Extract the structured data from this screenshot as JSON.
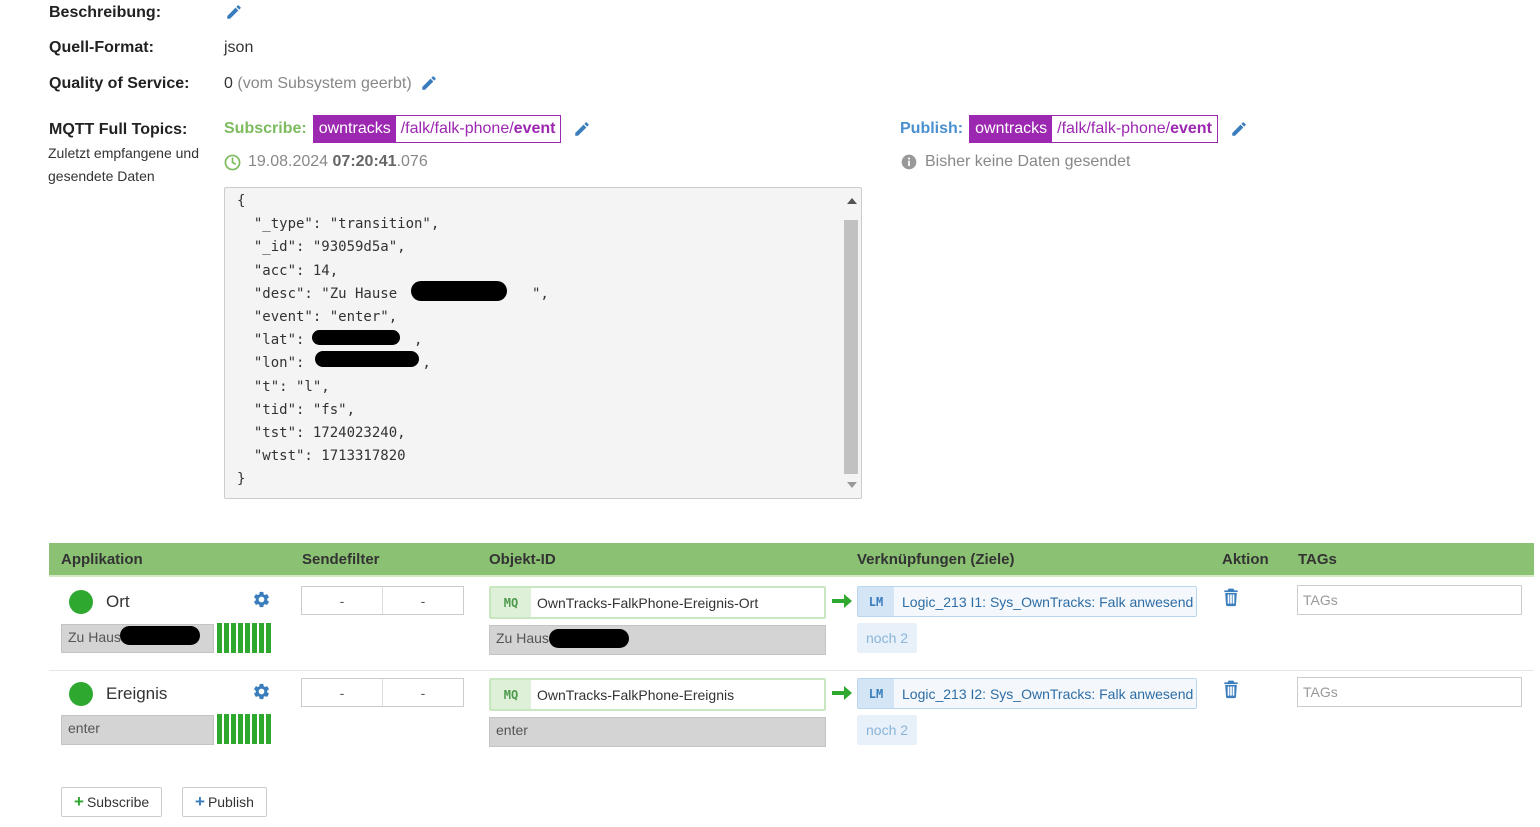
{
  "details": {
    "description_label": "Beschreibung:",
    "source_format_label": "Quell-Format:",
    "source_format_value": "json",
    "qos_label": "Quality of Service:",
    "qos_value": "0",
    "qos_note": "(vom Subsystem geerbt)",
    "mqtt_label": "MQTT Full Topics:",
    "mqtt_sub_note": "Zuletzt empfangene und gesendete Daten"
  },
  "subscribe": {
    "label": "Subscribe:",
    "prefix": "owntracks",
    "path": "/falk/falk-phone/",
    "path_end": "event",
    "timestamp_date": "19.08.2024",
    "timestamp_time": "07:20:41",
    "timestamp_ms": ".076"
  },
  "publish": {
    "label": "Publish:",
    "prefix": "owntracks",
    "path": "/falk/falk-phone/",
    "path_end": "event",
    "status": "Bisher keine Daten gesendet"
  },
  "json_payload": [
    "{",
    "  \"_type\": \"transition\",",
    "  \"_id\": \"93059d5a\",",
    "  \"acc\": 14,",
    "  \"desc\": \"Zu Hause                \",",
    "  \"event\": \"enter\",",
    "  \"lat\":             ,",
    "  \"lon\":              ,",
    "  \"t\": \"l\",",
    "  \"tid\": \"fs\",",
    "  \"tst\": 1724023240,",
    "  \"wtst\": 1713317820",
    "}"
  ],
  "table": {
    "headers": {
      "app": "Applikation",
      "filter": "Sendefilter",
      "object": "Objekt-ID",
      "links": "Verknüpfungen (Ziele)",
      "action": "Aktion",
      "tags": "TAGs"
    },
    "rows": [
      {
        "name": "Ort",
        "value": "Zu Hause",
        "filter_a": "-",
        "filter_b": "-",
        "obj_tag": "MQ",
        "obj_id": "OwnTracks-FalkPhone-Ereignis-Ort",
        "obj_value": "Zu Hause",
        "link_tag": "LM",
        "link_text": "Logic_213 I1: Sys_OwnTracks: Falk anwesend",
        "more": "noch 2",
        "tags_placeholder": "TAGs"
      },
      {
        "name": "Ereignis",
        "value": "enter",
        "filter_a": "-",
        "filter_b": "-",
        "obj_tag": "MQ",
        "obj_id": "OwnTracks-FalkPhone-Ereignis",
        "obj_value": "enter",
        "link_tag": "LM",
        "link_text": "Logic_213 I2: Sys_OwnTracks: Falk anwesend",
        "more": "noch 2",
        "tags_placeholder": "TAGs"
      }
    ]
  },
  "buttons": {
    "subscribe": "Subscribe",
    "publish": "Publish"
  },
  "colors": {
    "topic": "#9c27b0",
    "subscribe_label": "#7dbb5f",
    "publish_label": "#4a90d0",
    "header_bg": "#8bc173",
    "status_green": "#2fa82f",
    "icon_blue": "#3a7dbc"
  },
  "icons": {
    "edit": "pencil-icon",
    "clock": "clock-icon",
    "info": "info-icon",
    "settings": "gear-icon",
    "delete": "trash-icon",
    "arrow": "arrow-right-icon",
    "add": "plus-icon"
  }
}
